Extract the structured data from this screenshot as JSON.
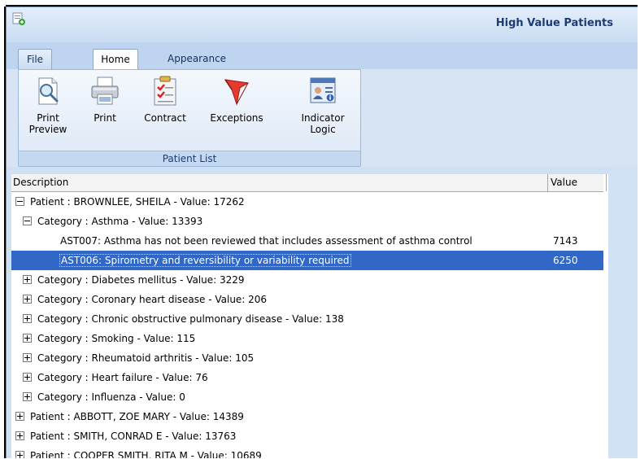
{
  "window": {
    "title": "High Value Patients"
  },
  "ribbon": {
    "tabs": [
      {
        "label": "File"
      },
      {
        "label": "Home"
      },
      {
        "label": "Appearance"
      }
    ],
    "group_label": "Patient List",
    "buttons": [
      {
        "label_line1": "Print",
        "label_line2": "Preview",
        "icon": "print-preview-icon"
      },
      {
        "label_line1": "Print",
        "label_line2": "",
        "icon": "printer-icon"
      },
      {
        "label_line1": "Contract",
        "label_line2": "",
        "icon": "clipboard-checklist-icon"
      },
      {
        "label_line1": "Exceptions",
        "label_line2": "",
        "icon": "red-flag-icon"
      },
      {
        "label_line1": "Indicator",
        "label_line2": "Logic",
        "icon": "indicator-logic-icon"
      }
    ]
  },
  "grid": {
    "columns": {
      "description": "Description",
      "value": "Value"
    },
    "rows": [
      {
        "level": 0,
        "expander": "minus",
        "text": "Patient : BROWNLEE, SHEILA - Value: 17262",
        "value": ""
      },
      {
        "level": 1,
        "expander": "minus",
        "text": "Category : Asthma - Value: 13393",
        "value": ""
      },
      {
        "level": 2,
        "expander": "",
        "text": "AST007: Asthma has not been reviewed that includes assessment of asthma control",
        "value": "7143"
      },
      {
        "level": 2,
        "expander": "",
        "text": "AST006: Spirometry and reversibility or variability required",
        "value": "6250",
        "selected": true
      },
      {
        "level": 1,
        "expander": "plus",
        "text": "Category : Diabetes mellitus - Value: 3229",
        "value": ""
      },
      {
        "level": 1,
        "expander": "plus",
        "text": "Category : Coronary heart disease - Value: 206",
        "value": ""
      },
      {
        "level": 1,
        "expander": "plus",
        "text": "Category : Chronic obstructive pulmonary disease - Value: 138",
        "value": ""
      },
      {
        "level": 1,
        "expander": "plus",
        "text": "Category : Smoking - Value: 115",
        "value": ""
      },
      {
        "level": 1,
        "expander": "plus",
        "text": "Category : Rheumatoid arthritis - Value: 105",
        "value": ""
      },
      {
        "level": 1,
        "expander": "plus",
        "text": "Category : Heart failure - Value: 76",
        "value": ""
      },
      {
        "level": 1,
        "expander": "plus",
        "text": "Category : Influenza - Value: 0",
        "value": ""
      },
      {
        "level": 0,
        "expander": "plus",
        "text": "Patient : ABBOTT, ZOE MARY - Value: 14389",
        "value": ""
      },
      {
        "level": 0,
        "expander": "plus",
        "text": "Patient : SMITH, CONRAD E - Value: 13763",
        "value": ""
      },
      {
        "level": 0,
        "expander": "plus",
        "text": "Patient : COOPER SMITH, RITA M - Value: 10689",
        "value": ""
      }
    ]
  },
  "colors": {
    "selection": "#3167c6",
    "title": "#1e3c74",
    "ribbon": "#cfe0f3"
  }
}
